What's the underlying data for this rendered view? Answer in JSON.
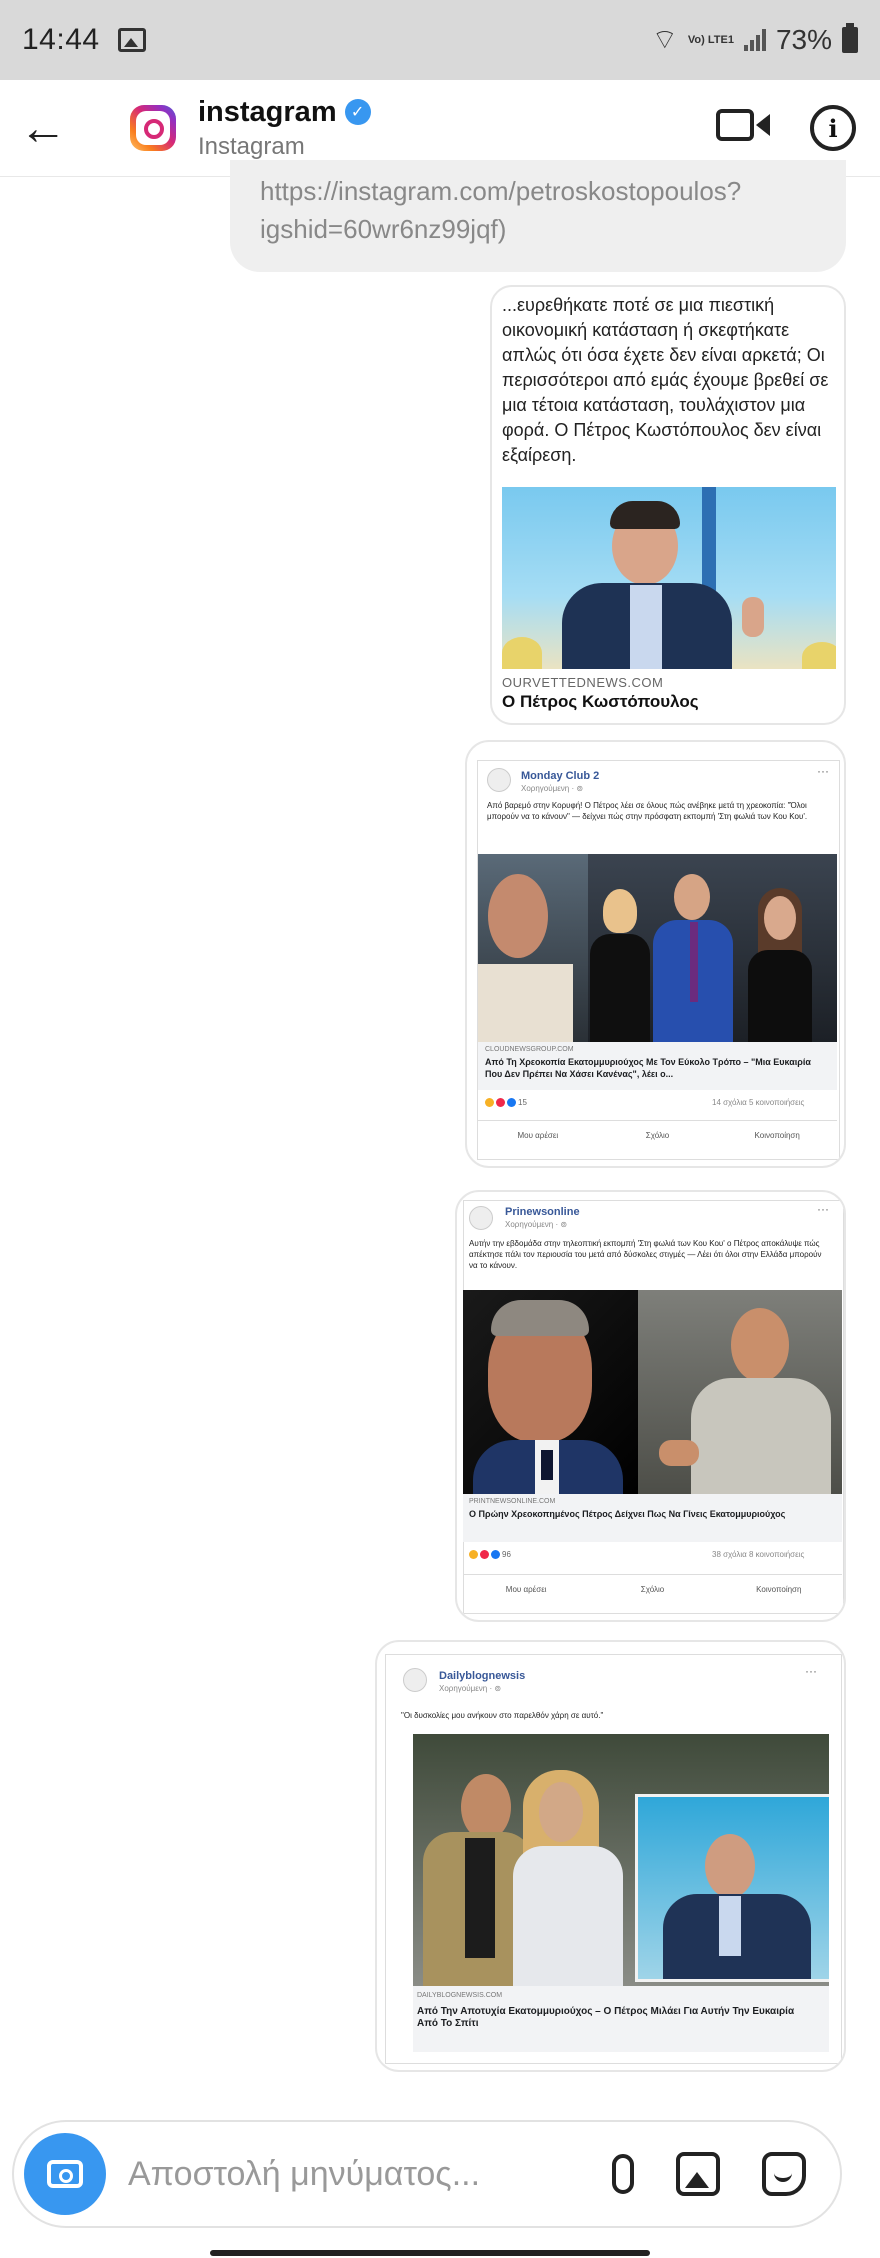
{
  "status_bar": {
    "time": "14:44",
    "network": "Vo) LTE1",
    "battery": "73%"
  },
  "header": {
    "name": "instagram",
    "subtitle": "Instagram"
  },
  "messages": {
    "link_text": "https://instagram.com/petroskostopoulos?igshid=60wr6nz99jqf)",
    "card1": {
      "text": "...ευρεθήκατε ποτέ σε μια πιεστική οικονομική κατάσταση ή σκεφτήκατε απλώς ότι όσα έχετε δεν είναι αρκετά; Οι περισσότεροι από εμάς έχουμε βρεθεί σε μια τέτοια κατάσταση, τουλάχιστον μια φορά. Ο Πέτρος Κωστόπουλος δεν είναι εξαίρεση.",
      "source": "OURVETTEDNEWS.COM",
      "title": "Ο Πέτρος Κωστόπουλος"
    },
    "fb1": {
      "page": "Monday Club 2",
      "meta": "Χορηγούμενη · ⊚",
      "post": "Από βαρεμό στην Κορυφή! Ο Πέτρος λέει σε όλους πώς ανέβηκε μετά τη χρεοκοπία: \"Όλοι μπορούν να το κάνουν\" — δείχνει πώς στην πρόσφατη εκπομπή 'Στη φωλιά των Κου Κου'.",
      "link_source": "CLOUDNEWSGROUP.COM",
      "link_title": "Από Τη Χρεοκοπία Εκατομμυριούχος Με Τον Εύκολο Τρόπο – \"Μια Ευκαιρία Που Δεν Πρέπει Να Χάσει Κανένας\", λέει ο...",
      "reactions": "15",
      "counts": "14 σχόλια  5 κοινοποιήσεις",
      "actions": [
        "Μου αρέσει",
        "Σχόλιο",
        "Κοινοποίηση"
      ]
    },
    "fb2": {
      "page": "Prinewsonline",
      "meta": "Χορηγούμενη · ⊚",
      "post": "Αυτήν την εβδομάδα στην τηλεοπτική εκπομπή 'Στη φωλιά των Κου Κου' ο Πέτρος αποκάλυψε πώς απέκτησε πάλι τον περιουσία του μετά από δύσκολες στιγμές — Λέει ότι όλοι στην Ελλάδα μπορούν να το κάνουν.",
      "link_source": "PRINTNEWSONLINE.COM",
      "link_title": "Ο Πρώην Χρεοκοπημένος Πέτρος Δείχνει Πως Να Γίνεις Εκατομμυριούχος",
      "reactions": "96",
      "counts": "38 σχόλια  8 κοινοποιήσεις",
      "actions": [
        "Μου αρέσει",
        "Σχόλιο",
        "Κοινοποίηση"
      ]
    },
    "fb3": {
      "page": "Dailyblognewsis",
      "meta": "Χορηγούμενη · ⊚",
      "post": "\"Οι δυσκολίες μου ανήκουν στο παρελθόν χάρη σε αυτό.\"",
      "link_source": "DAILYBLOGNEWSIS.COM",
      "link_title": "Από Την Αποτυχία Εκατομμυριούχος – Ο Πέτρος Μιλάει Για Αυτήν Την Ευκαιρία Από Το Σπίτι"
    }
  },
  "composer": {
    "placeholder": "Αποστολή μηνύματος..."
  },
  "colors": {
    "accent": "#3897f0",
    "bubble": "#efefef",
    "statusbar": "#d9d9d9"
  }
}
